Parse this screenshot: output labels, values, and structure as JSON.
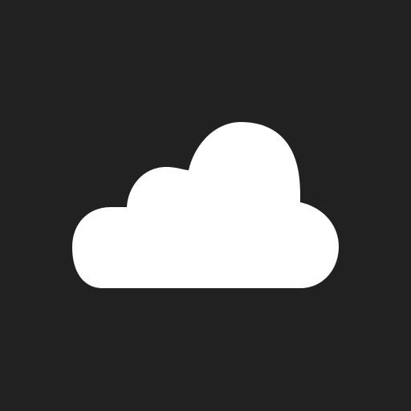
{
  "icon": {
    "name": "cloud-icon"
  },
  "colors": {
    "background": "#212121",
    "icon_fill": "#ffffff"
  }
}
